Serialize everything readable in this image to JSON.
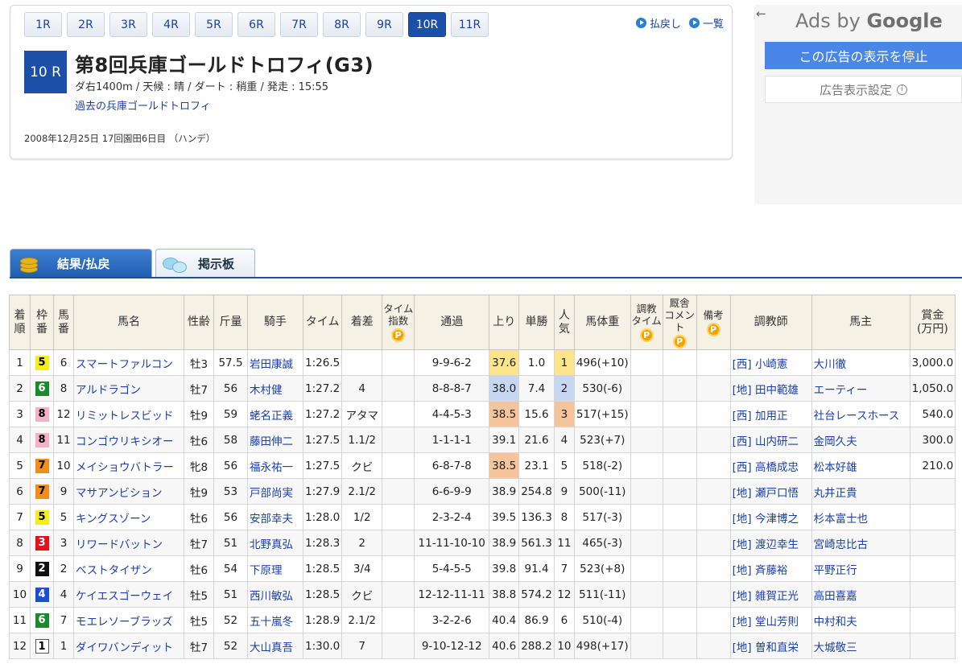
{
  "race_tabs": [
    "1R",
    "2R",
    "3R",
    "4R",
    "5R",
    "6R",
    "7R",
    "8R",
    "9R",
    "10R",
    "11R"
  ],
  "active_race_index": 9,
  "top_links": {
    "payout": "払戻し",
    "list": "一覧"
  },
  "race": {
    "number_label": "10 R",
    "name": "第8回兵庫ゴールドトロフィ(G3)",
    "info": "ダ右1400m / 天候 : 晴 / ダート : 稍重 / 発走 : 15:55",
    "past_link": "過去の兵庫ゴールドトロフィ",
    "date": "2008年12月25日 17回園田6日目 （ハンデ）"
  },
  "ads": {
    "back": "←",
    "title_ads": "Ads by ",
    "title_brand": "Google",
    "stop_button": "この広告の表示を停止",
    "settings_button": "広告表示設定",
    "info_icon": "i"
  },
  "content_tabs": {
    "results": "結果/払戻",
    "board": "掲示板"
  },
  "table": {
    "headers": {
      "rank": [
        "着",
        "順"
      ],
      "waku": [
        "枠",
        "番"
      ],
      "umaban": [
        "馬",
        "番"
      ],
      "name": "馬名",
      "sex_age": "性齢",
      "weight": "斤量",
      "jockey": "騎手",
      "time": "タイム",
      "margin": "着差",
      "time_index": [
        "タイム",
        "指数"
      ],
      "passing": "通過",
      "last3f": "上り",
      "odds": "単勝",
      "popularity": [
        "人",
        "気"
      ],
      "body_weight": "馬体重",
      "training_time": [
        "調教",
        "タイム"
      ],
      "stable_comment": [
        "厩舎",
        "コメント"
      ],
      "remarks": "備考",
      "trainer": "調教師",
      "owner": "馬主",
      "prize": [
        "賞金",
        "(万円)"
      ],
      "premium_badge": "P"
    },
    "rows": [
      {
        "rank": "1",
        "waku": "5",
        "umaban": "6",
        "name": "スマートファルコン",
        "sex_age": "牡3",
        "weight": "57.5",
        "jockey": "岩田康誠",
        "time": "1:26.5",
        "margin": "",
        "passing": "9-9-6-2",
        "last3f": "37.6",
        "odds": "1.0",
        "popularity": "1",
        "body_weight": "496(+10)",
        "trainer": "[西] 小崎憲",
        "owner": "大川徹",
        "prize": "3,000.0"
      },
      {
        "rank": "2",
        "waku": "6",
        "umaban": "8",
        "name": "アルドラゴン",
        "sex_age": "牡7",
        "weight": "56",
        "jockey": "木村健",
        "time": "1:27.2",
        "margin": "4",
        "passing": "8-8-8-7",
        "last3f": "38.0",
        "odds": "7.4",
        "popularity": "2",
        "body_weight": "530(-6)",
        "trainer": "[地] 田中範雄",
        "owner": "エーティー",
        "prize": "1,050.0"
      },
      {
        "rank": "3",
        "waku": "8",
        "umaban": "12",
        "name": "リミットレスビッド",
        "sex_age": "牡9",
        "weight": "59",
        "jockey": "蛯名正義",
        "time": "1:27.2",
        "margin": "アタマ",
        "passing": "4-4-5-3",
        "last3f": "38.5",
        "odds": "15.6",
        "popularity": "3",
        "body_weight": "517(+15)",
        "trainer": "[西] 加用正",
        "owner": "社台レースホース",
        "prize": "540.0"
      },
      {
        "rank": "4",
        "waku": "8",
        "umaban": "11",
        "name": "コンゴウリキシオー",
        "sex_age": "牡6",
        "weight": "58",
        "jockey": "藤田伸二",
        "time": "1:27.5",
        "margin": "1.1/2",
        "passing": "1-1-1-1",
        "last3f": "39.1",
        "odds": "21.6",
        "popularity": "4",
        "body_weight": "523(+7)",
        "trainer": "[西] 山内研二",
        "owner": "金岡久夫",
        "prize": "300.0"
      },
      {
        "rank": "5",
        "waku": "7",
        "umaban": "10",
        "name": "メイショウバトラー",
        "sex_age": "牝8",
        "weight": "56",
        "jockey": "福永祐一",
        "time": "1:27.5",
        "margin": "クビ",
        "passing": "6-8-7-8",
        "last3f": "38.5",
        "odds": "23.1",
        "popularity": "5",
        "body_weight": "518(-2)",
        "trainer": "[西] 高橋成忠",
        "owner": "松本好雄",
        "prize": "210.0"
      },
      {
        "rank": "6",
        "waku": "7",
        "umaban": "9",
        "name": "マサアンビション",
        "sex_age": "牡9",
        "weight": "53",
        "jockey": "戸部尚実",
        "time": "1:27.9",
        "margin": "2.1/2",
        "passing": "6-6-9-9",
        "last3f": "38.9",
        "odds": "254.8",
        "popularity": "9",
        "body_weight": "500(-11)",
        "trainer": "[地] 瀬戸口悟",
        "owner": "丸井正貴",
        "prize": ""
      },
      {
        "rank": "7",
        "waku": "5",
        "umaban": "5",
        "name": "キングスゾーン",
        "sex_age": "牡6",
        "weight": "56",
        "jockey": "安部幸夫",
        "time": "1:28.0",
        "margin": "1/2",
        "passing": "2-3-2-4",
        "last3f": "39.5",
        "odds": "136.3",
        "popularity": "8",
        "body_weight": "517(-3)",
        "trainer": "[地] 今津博之",
        "owner": "杉本富士也",
        "prize": ""
      },
      {
        "rank": "8",
        "waku": "3",
        "umaban": "3",
        "name": "リワードバットン",
        "sex_age": "牡7",
        "weight": "51",
        "jockey": "北野真弘",
        "time": "1:28.3",
        "margin": "2",
        "passing": "11-11-10-10",
        "last3f": "38.9",
        "odds": "561.3",
        "popularity": "11",
        "body_weight": "465(-3)",
        "trainer": "[地] 渡辺幸生",
        "owner": "宮崎忠比古",
        "prize": ""
      },
      {
        "rank": "9",
        "waku": "2",
        "umaban": "2",
        "name": "ベストタイザン",
        "sex_age": "牡6",
        "weight": "54",
        "jockey": "下原理",
        "time": "1:28.5",
        "margin": "3/4",
        "passing": "5-4-5-5",
        "last3f": "39.8",
        "odds": "91.4",
        "popularity": "7",
        "body_weight": "523(+8)",
        "trainer": "[地] 斉藤裕",
        "owner": "平野正行",
        "prize": ""
      },
      {
        "rank": "10",
        "waku": "4",
        "umaban": "4",
        "name": "ケイエスゴーウェイ",
        "sex_age": "牡5",
        "weight": "51",
        "jockey": "西川敏弘",
        "time": "1:28.5",
        "margin": "クビ",
        "passing": "12-12-11-11",
        "last3f": "38.8",
        "odds": "574.2",
        "popularity": "12",
        "body_weight": "511(-11)",
        "trainer": "[地] 雑賀正光",
        "owner": "高田喜嘉",
        "prize": ""
      },
      {
        "rank": "11",
        "waku": "6",
        "umaban": "7",
        "name": "モエレソーブラッズ",
        "sex_age": "牡5",
        "weight": "52",
        "jockey": "五十嵐冬",
        "time": "1:28.9",
        "margin": "2.1/2",
        "passing": "3-2-2-6",
        "last3f": "40.4",
        "odds": "86.9",
        "popularity": "6",
        "body_weight": "510(-4)",
        "trainer": "[地] 堂山芳則",
        "owner": "中村和夫",
        "prize": ""
      },
      {
        "rank": "12",
        "waku": "1",
        "umaban": "1",
        "name": "ダイワバンディット",
        "sex_age": "牡7",
        "weight": "52",
        "jockey": "大山真吾",
        "time": "1:30.0",
        "margin": "7",
        "passing": "9-10-12-12",
        "last3f": "40.6",
        "odds": "288.2",
        "popularity": "10",
        "body_weight": "498(+17)",
        "trainer": "[地] 曽和直栄",
        "owner": "大城敬三",
        "prize": ""
      }
    ],
    "highlight_colors": {
      "first": "#fbe48a",
      "second": "#c7d7f2",
      "third": "#f5c49a"
    }
  }
}
